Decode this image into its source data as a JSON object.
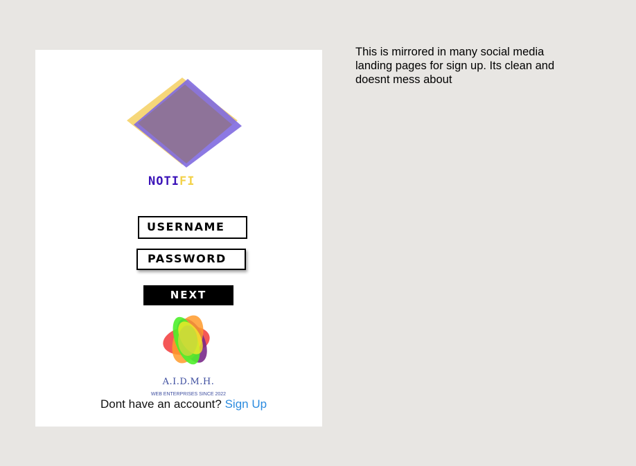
{
  "brand": {
    "part1": "NOTI",
    "part2": "FI"
  },
  "form": {
    "username_label": "USERNAME",
    "password_label": "PASSWORD",
    "next_label": "NEXT"
  },
  "enterprise": {
    "name": "A.I.D.M.H.",
    "tagline": "WEB ENTERPRISES SINCE 2022"
  },
  "signup": {
    "prompt": "Dont have an account?",
    "link": "Sign Up"
  },
  "note": "This is mirrored in many social media landing pages for sign up.  Its clean and doesnt mess about",
  "colors": {
    "brand_purple": "#3b13b8",
    "brand_yellow": "#f3d24a",
    "link_blue": "#2b8bdf",
    "background": "#e8e6e3"
  }
}
